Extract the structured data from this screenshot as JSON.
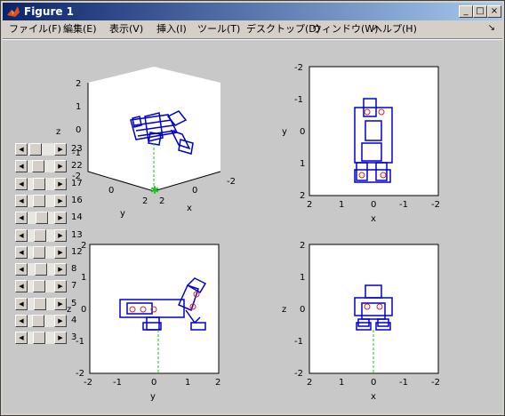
{
  "window": {
    "title": "Figure 1",
    "minimize": "_",
    "maximize": "□",
    "close": "×"
  },
  "menu": [
    "ファイル(F)",
    "編集(E)",
    "表示(V)",
    "挿入(I)",
    "ツール(T)",
    "デスクトップ(D)",
    "ウィンドウ(W)",
    "ヘルプ(H)"
  ],
  "dock_arrow": "↘",
  "axes": {
    "view3d": {
      "xlabel": "x",
      "ylabel": "y",
      "zlabel": "z",
      "z_ticks": [
        "2",
        "1",
        "0",
        "-1",
        "-2"
      ],
      "x_ticks": [
        "2",
        "0",
        "-2"
      ],
      "y_ticks": [
        "0",
        "2"
      ]
    },
    "top_right": {
      "xlabel": "x",
      "ylabel": "y",
      "x_ticks": [
        "2",
        "1",
        "0",
        "-1",
        "-2"
      ],
      "y_ticks": [
        "-2",
        "-1",
        "0",
        "1",
        "2"
      ]
    },
    "bottom_left": {
      "xlabel": "y",
      "ylabel": "z",
      "x_ticks": [
        "-2",
        "-1",
        "0",
        "1",
        "2"
      ],
      "y_ticks": [
        "2",
        "1",
        "0",
        "-1",
        "-2"
      ]
    },
    "bottom_right": {
      "xlabel": "x",
      "ylabel": "z",
      "x_ticks": [
        "2",
        "1",
        "0",
        "-1",
        "-2"
      ],
      "y_ticks": [
        "2",
        "1",
        "0",
        "-1",
        "-2"
      ]
    }
  },
  "sliders": {
    "labels": [
      "23",
      "22",
      "17",
      "16",
      "14",
      "13",
      "12",
      "8",
      "7",
      "5",
      "4",
      "3"
    ],
    "positions": [
      0.1,
      0.3,
      0.4,
      0.35,
      0.55,
      0.45,
      0.4,
      0.5,
      0.35,
      0.45,
      0.3,
      0.4
    ]
  }
}
